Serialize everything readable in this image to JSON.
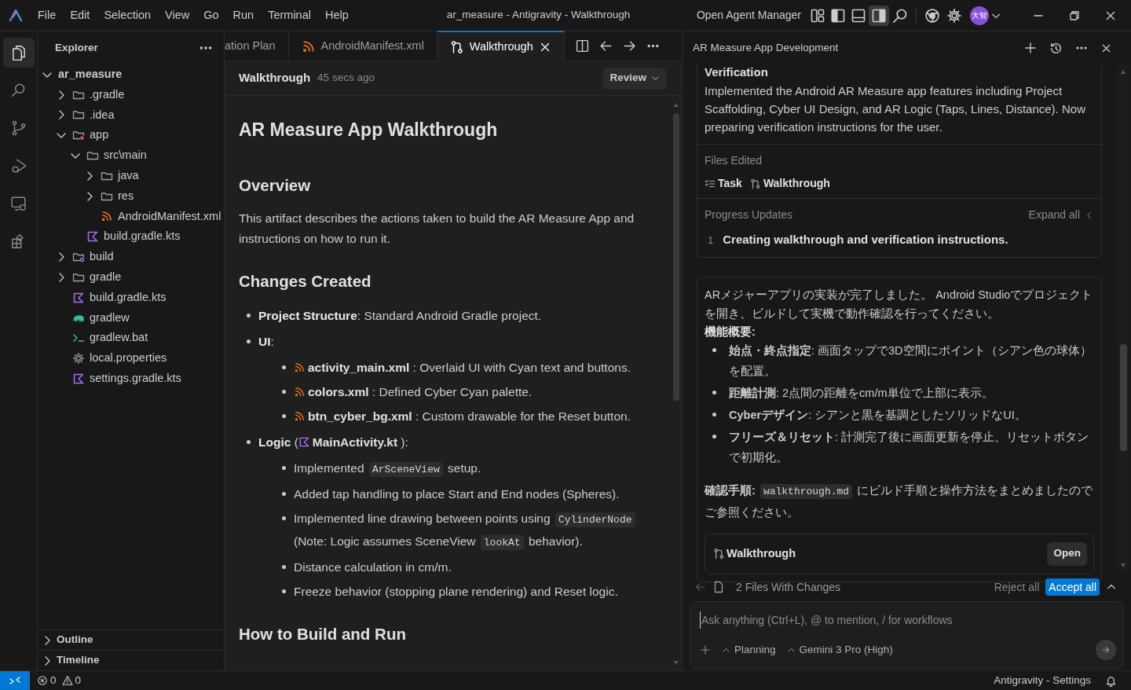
{
  "menu": [
    "File",
    "Edit",
    "Selection",
    "View",
    "Go",
    "Run",
    "Terminal",
    "Help"
  ],
  "window": {
    "title": "ar_measure - Antigravity - Walkthrough",
    "agent_manager": "Open Agent Manager",
    "avatar": "大智"
  },
  "layout_toggles": [
    {
      "kind": "grid",
      "on": false
    },
    {
      "kind": "left",
      "on": false
    },
    {
      "kind": "bottom",
      "on": false
    },
    {
      "kind": "right",
      "on": true
    }
  ],
  "activity_bar": [
    {
      "kind": "files",
      "selected": true
    },
    {
      "kind": "search",
      "selected": false
    },
    {
      "kind": "branch",
      "selected": false
    },
    {
      "kind": "debug",
      "selected": false
    },
    {
      "kind": "remote",
      "selected": false
    },
    {
      "kind": "extensions",
      "selected": false
    }
  ],
  "explorer": {
    "title": "Explorer",
    "tree": [
      {
        "label": "ar_measure",
        "kind": "root",
        "expanded": true,
        "children": [
          {
            "label": ".gradle",
            "kind": "folder",
            "expanded": false
          },
          {
            "label": ".idea",
            "kind": "folder",
            "expanded": false
          },
          {
            "label": "app",
            "kind": "folder-app",
            "expanded": true,
            "children": [
              {
                "label": "src\\main",
                "kind": "folder",
                "expanded": true,
                "children": [
                  {
                    "label": "java",
                    "kind": "folder",
                    "expanded": false
                  },
                  {
                    "label": "res",
                    "kind": "folder",
                    "expanded": false
                  },
                  {
                    "label": "AndroidManifest.xml",
                    "kind": "xml"
                  }
                ]
              },
              {
                "label": "build.gradle.kts",
                "kind": "kotlin"
              }
            ]
          },
          {
            "label": "build",
            "kind": "folder-build",
            "expanded": false
          },
          {
            "label": "gradle",
            "kind": "folder",
            "expanded": false
          },
          {
            "label": "build.gradle.kts",
            "kind": "kotlin"
          },
          {
            "label": "gradlew",
            "kind": "gradle"
          },
          {
            "label": "gradlew.bat",
            "kind": "terminal"
          },
          {
            "label": "local.properties",
            "kind": "gear"
          },
          {
            "label": "settings.gradle.kts",
            "kind": "kotlin"
          }
        ]
      }
    ],
    "sections": [
      {
        "label": "Outline",
        "expanded": false
      },
      {
        "label": "Timeline",
        "expanded": false
      }
    ]
  },
  "editor": {
    "tabs": [
      {
        "label": "ation Plan",
        "kind": "doc",
        "selected": false
      },
      {
        "label": "AndroidManifest.xml",
        "kind": "xml",
        "selected": false
      },
      {
        "label": "Walkthrough",
        "kind": "walkthrough",
        "selected": true
      }
    ],
    "doc_title": "Walkthrough",
    "doc_time": "45 secs ago",
    "review": "Review",
    "blocks": [
      {
        "kind": "h1",
        "text": "AR Measure App Walkthrough"
      },
      {
        "kind": "h2",
        "text": "Overview"
      },
      {
        "kind": "p",
        "text": "This artifact describes the actions taken to build the AR Measure App and instructions on how to run it."
      },
      {
        "kind": "h2",
        "text": "Changes Created"
      },
      {
        "kind": "list",
        "items": [
          {
            "parts": [
              {
                "kind": "text",
                "text": "**Project Structure**: Standard Android Gradle project."
              }
            ]
          },
          {
            "parts": [
              {
                "kind": "text",
                "text": "**UI**:"
              }
            ],
            "children": [
              {
                "parts": [
                  {
                    "kind": "xml-file",
                    "text": "activity_main.xml"
                  },
                  {
                    "kind": "text",
                    "text": " : Overlaid UI with Cyan text and buttons."
                  }
                ]
              },
              {
                "parts": [
                  {
                    "kind": "xml-file",
                    "text": "colors.xml"
                  },
                  {
                    "kind": "text",
                    "text": " : Defined Cyber Cyan palette."
                  }
                ]
              },
              {
                "parts": [
                  {
                    "kind": "xml-file",
                    "text": "btn_cyber_bg.xml"
                  },
                  {
                    "kind": "text",
                    "text": " : Custom drawable for the Reset button."
                  }
                ]
              }
            ]
          },
          {
            "parts": [
              {
                "kind": "text",
                "text": "**Logic** ("
              },
              {
                "kind": "kotlin-file",
                "text": "MainActivity.kt"
              },
              {
                "kind": "text",
                "text": " ):"
              }
            ],
            "children": [
              {
                "parts": [
                  {
                    "kind": "text",
                    "text": "Implemented "
                  },
                  {
                    "kind": "code",
                    "text": "ArSceneView"
                  },
                  {
                    "kind": "text",
                    "text": " setup."
                  }
                ]
              },
              {
                "parts": [
                  {
                    "kind": "text",
                    "text": "Added tap handling to place Start and End nodes (Spheres)."
                  }
                ]
              },
              {
                "parts": [
                  {
                    "kind": "text",
                    "text": "Implemented line drawing between points using "
                  },
                  {
                    "kind": "code",
                    "text": "CylinderNode"
                  },
                  {
                    "kind": "text",
                    "text": " (Note: Logic assumes SceneView "
                  },
                  {
                    "kind": "code",
                    "text": "lookAt"
                  },
                  {
                    "kind": "text",
                    "text": " behavior)."
                  }
                ]
              },
              {
                "parts": [
                  {
                    "kind": "text",
                    "text": "Distance calculation in cm/m."
                  }
                ]
              },
              {
                "parts": [
                  {
                    "kind": "text",
                    "text": "Freeze behavior (stopping plane rendering) and Reset logic."
                  }
                ]
              }
            ]
          }
        ]
      },
      {
        "kind": "h2",
        "text": "How to Build and Run"
      }
    ]
  },
  "agent": {
    "title": "AR Measure App Development",
    "task": {
      "title": "Verification",
      "summary": "Implemented the Android AR Measure app features including Project Scaffolding, Cyber UI Design, and AR Logic (Taps, Lines, Distance). Now preparing verification instructions for the user.",
      "files_label": "Files Edited",
      "files": [
        {
          "kind": "task",
          "label": "Task"
        },
        {
          "kind": "walkthrough",
          "label": "Walkthrough"
        }
      ],
      "progress_label": "Progress Updates",
      "expand": "Expand all",
      "updates": [
        {
          "number": "1",
          "text": "Creating walkthrough and verification instructions."
        }
      ]
    },
    "message": {
      "intro": "ARメジャーアプリの実装が完了しました。 Android Studioでプロジェクトを開き、ビルドして実機で動作確認を行ってください。",
      "heading": "機能概要:",
      "bullets": [
        "**始点・終点指定**: 画面タップで3D空間にポイント（シアン色の球体）を配置。",
        "**距離計測**: 2点間の距離をcm/m単位で上部に表示。",
        "**Cyberデザイン**: シアンと黒を基調としたソリッドなUI。",
        "**フリーズ＆リセット**: 計測完了後に画面更新を停止、リセットボタンで初期化。"
      ],
      "note": [
        {
          "kind": "text",
          "text": "**確認手順:** "
        },
        {
          "kind": "code",
          "text": "walkthrough.md"
        },
        {
          "kind": "text",
          "text": " にビルド手順と操作方法をまとめましたのでご参照ください。"
        }
      ],
      "artifact": {
        "label": "Walkthrough",
        "button": "Open"
      }
    },
    "changes": {
      "label": "2 Files With Changes",
      "reject": "Reject all",
      "accept": "Accept all"
    },
    "input": {
      "placeholder": "Ask anything (Ctrl+L), @ to mention, / for workflows",
      "mode": "Planning",
      "model": "Gemini 3 Pro (High)"
    }
  },
  "status_bar": {
    "errors": "0",
    "warnings": "0",
    "right": "Antigravity - Settings"
  }
}
